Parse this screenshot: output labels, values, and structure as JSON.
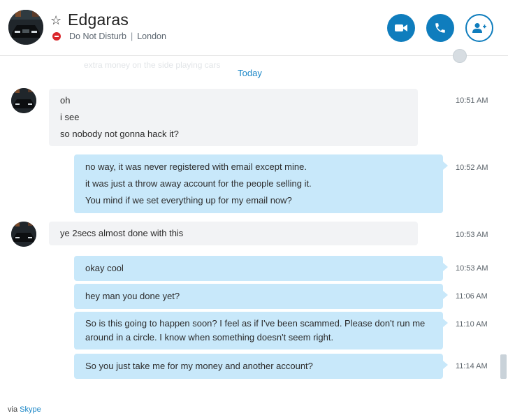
{
  "header": {
    "contact_name": "Edgaras",
    "status": "Do Not Disturb",
    "location": "London",
    "separator": "|",
    "buttons": [
      "video-call",
      "audio-call",
      "add-people"
    ]
  },
  "conversation": {
    "faded_preview": "extra money on the side playing cars",
    "date_divider": "Today",
    "messages": [
      {
        "direction": "in",
        "time": "10:51 AM",
        "lines": [
          "oh",
          "i see",
          "so nobody not gonna hack it?"
        ]
      },
      {
        "direction": "out",
        "time": "10:52 AM",
        "lines": [
          "no way, it was never registered with email except mine.",
          "it was just a throw away account for the people selling it.",
          "You mind if we set everything up for my email now?"
        ]
      },
      {
        "direction": "in",
        "time": "10:53 AM",
        "lines": [
          "ye 2secs almost done with this"
        ]
      },
      {
        "direction": "out",
        "time": "10:53 AM",
        "lines": [
          "okay cool"
        ]
      },
      {
        "direction": "out",
        "time": "11:06 AM",
        "lines": [
          "hey man you done yet?"
        ]
      },
      {
        "direction": "out",
        "time": "11:10 AM",
        "lines": [
          "So is this going to happen soon? I feel as if I've been scammed. Please don't run me around in a circle. I know when something doesn't seem right."
        ]
      },
      {
        "direction": "out",
        "time": "11:14 AM",
        "lines": [
          "So you just take me for my money and another account?"
        ]
      }
    ]
  },
  "footer": {
    "prefix": "via",
    "link": "Skype"
  },
  "colors": {
    "accent": "#0f7dbd",
    "outgoing_bubble": "#c8e8fa",
    "incoming_bubble": "#f2f3f5",
    "dnd": "#d9262b"
  }
}
